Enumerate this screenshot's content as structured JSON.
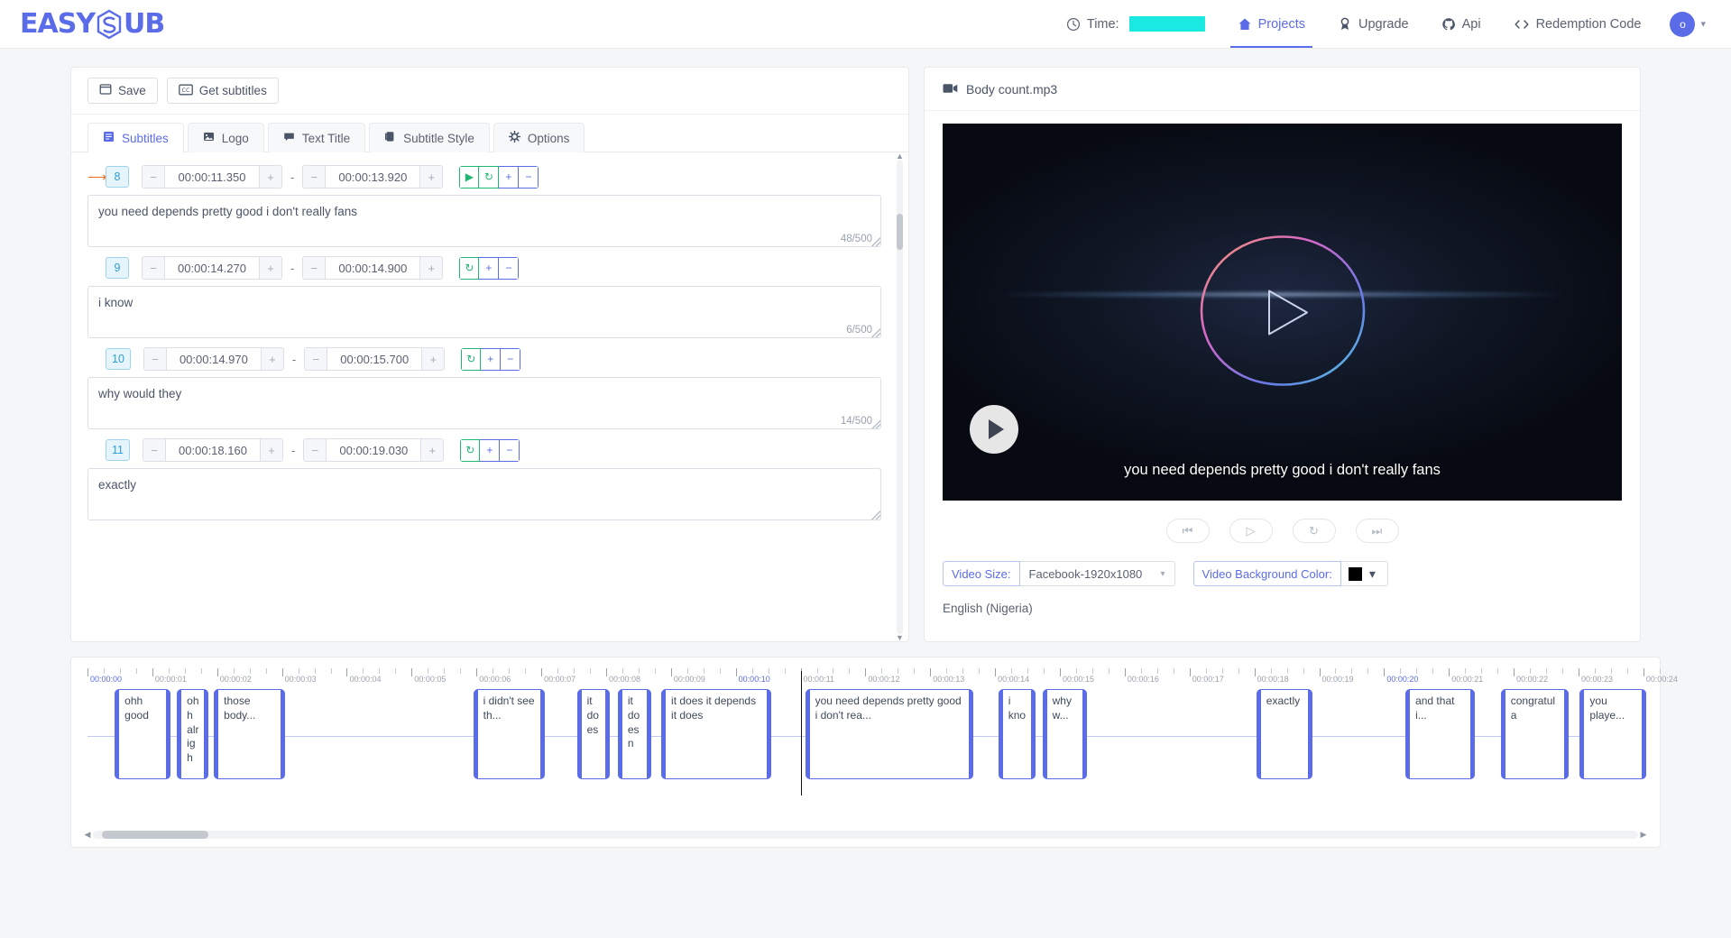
{
  "brand": {
    "name": "EASYSUB",
    "text_left": "EASY",
    "text_right": "UB"
  },
  "nav": {
    "time_label": "Time:",
    "time_value_redacted": "",
    "items": [
      {
        "label": "Projects",
        "icon": "home-icon",
        "active": true
      },
      {
        "label": "Upgrade",
        "icon": "medal-icon",
        "active": false
      },
      {
        "label": "Api",
        "icon": "github-icon",
        "active": false
      },
      {
        "label": "Redemption Code",
        "icon": "code-brackets-icon",
        "active": false
      }
    ],
    "avatar_initial": "o"
  },
  "editor": {
    "toolbar": {
      "save_label": "Save",
      "get_subtitles_label": "Get subtitles"
    },
    "tabs": [
      {
        "label": "Subtitles",
        "icon": "list-icon",
        "active": true
      },
      {
        "label": "Logo",
        "icon": "image-icon",
        "active": false
      },
      {
        "label": "Text Title",
        "icon": "comment-icon",
        "active": false
      },
      {
        "label": "Subtitle Style",
        "icon": "layers-icon",
        "active": false
      },
      {
        "label": "Options",
        "icon": "gear-icon",
        "active": false
      }
    ],
    "subtitles": [
      {
        "index": "8",
        "start": "00:00:11.350",
        "end": "00:00:13.920",
        "text": "you need depends pretty good i don't really fans",
        "counter": "48/500",
        "current": true,
        "has_play": true
      },
      {
        "index": "9",
        "start": "00:00:14.270",
        "end": "00:00:14.900",
        "text": "i know",
        "counter": "6/500",
        "current": false,
        "has_play": false
      },
      {
        "index": "10",
        "start": "00:00:14.970",
        "end": "00:00:15.700",
        "text": "why would they",
        "counter": "14/500",
        "current": false,
        "has_play": false
      },
      {
        "index": "11",
        "start": "00:00:18.160",
        "end": "00:00:19.030",
        "text": "exactly",
        "counter": "",
        "current": false,
        "has_play": false
      }
    ],
    "separator": "-"
  },
  "preview": {
    "file_name": "Body count.mp3",
    "caption": "you need depends pretty good i don't really fans",
    "controls": [
      {
        "name": "skip-back-icon",
        "glyph": "⏮"
      },
      {
        "name": "play-icon",
        "glyph": "▷"
      },
      {
        "name": "replay-icon",
        "glyph": "↻"
      },
      {
        "name": "skip-forward-icon",
        "glyph": "⏭"
      }
    ],
    "video_size_label": "Video Size:",
    "video_size_value": "Facebook-1920x1080",
    "video_bg_label": "Video Background Color:",
    "video_bg_color": "#000000",
    "language": "English (Nigeria)"
  },
  "timeline": {
    "tick_labels": [
      "00:00:00",
      "00:00:01",
      "00:00:02",
      "00:00:03",
      "00:00:04",
      "00:00:05",
      "00:00:06",
      "00:00:07",
      "00:00:08",
      "00:00:09",
      "00:00:10",
      "00:00:11",
      "00:00:12",
      "00:00:13",
      "00:00:14",
      "00:00:15",
      "00:00:16",
      "00:00:17",
      "00:00:18",
      "00:00:19",
      "00:00:20",
      "00:00:21",
      "00:00:22",
      "00:00:23",
      "00:00:24"
    ],
    "highlighted_ticks": [
      "00:00:00",
      "00:00:10",
      "00:00:20"
    ],
    "playhead_time": "00:00:11",
    "clips": [
      {
        "text": "ohh good",
        "start_s": 0.42,
        "end_s": 1.28
      },
      {
        "text": "ohh alrigh",
        "start_s": 1.38,
        "end_s": 1.86
      },
      {
        "text": "those body...",
        "start_s": 1.95,
        "end_s": 3.05
      },
      {
        "text": "i didn't see th...",
        "start_s": 5.95,
        "end_s": 7.05
      },
      {
        "text": "it does",
        "start_s": 7.55,
        "end_s": 8.05
      },
      {
        "text": "it doesn",
        "start_s": 8.18,
        "end_s": 8.7
      },
      {
        "text": "it does it depends it does",
        "start_s": 8.85,
        "end_s": 10.55
      },
      {
        "text": "you need depends pretty good i don't rea...",
        "start_s": 11.07,
        "end_s": 13.67
      },
      {
        "text": "i kno",
        "start_s": 14.05,
        "end_s": 14.62
      },
      {
        "text": "why w...",
        "start_s": 14.73,
        "end_s": 15.42
      },
      {
        "text": "exactly",
        "start_s": 18.03,
        "end_s": 18.9
      },
      {
        "text": "and that i...",
        "start_s": 20.33,
        "end_s": 21.4
      },
      {
        "text": "congratula",
        "start_s": 21.8,
        "end_s": 22.85
      },
      {
        "text": "you playe...",
        "start_s": 23.02,
        "end_s": 24.05
      }
    ]
  }
}
